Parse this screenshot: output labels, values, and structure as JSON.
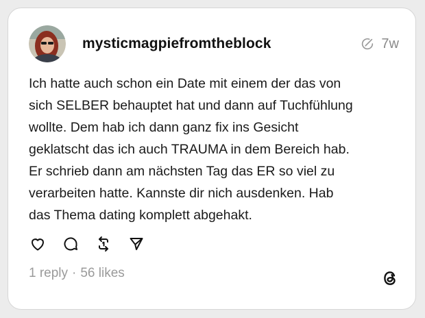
{
  "post": {
    "username": "mysticmagpiefromtheblock",
    "time": "7w",
    "text": "Ich hatte auch schon ein Date mit einem der das von\nsich SELBER behauptet hat und dann auf Tuchfühlung\nwollte. Dem hab ich dann ganz fix ins Gesicht\ngeklatscht das ich auch TRAUMA in dem Bereich hab.\nEr schrieb dann am nächsten Tag das ER so viel zu\nverarbeiten hatte. Kannste dir nich ausdenken. Hab\ndas Thema dating komplett abgehakt.",
    "replies": "1 reply",
    "separator": "·",
    "likes": "56 likes"
  },
  "icons": {
    "edited": "edit-circle-icon",
    "like": "heart-icon",
    "reply": "comment-icon",
    "repost": "repost-icon",
    "share": "send-icon",
    "logo": "threads-logo-icon"
  },
  "colors": {
    "background": "#ececec",
    "card": "#ffffff",
    "muted": "#8a8a8a",
    "text": "#1a1a1a"
  }
}
